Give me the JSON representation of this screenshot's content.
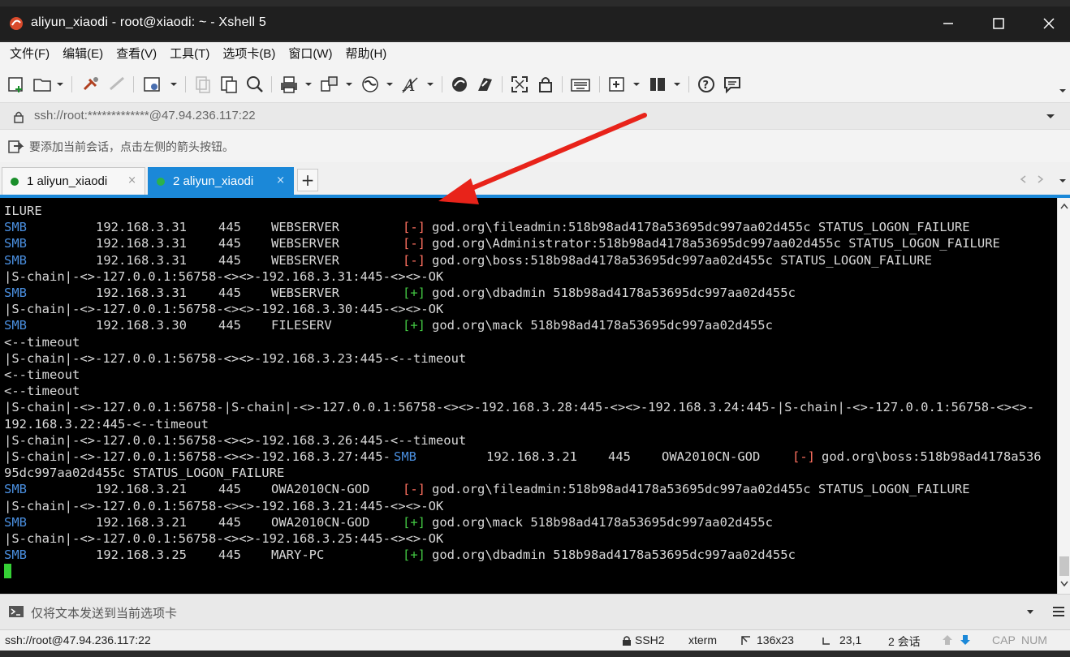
{
  "window": {
    "title": "aliyun_xiaodi - root@xiaodi: ~ - Xshell 5"
  },
  "menu": [
    "文件(F)",
    "编辑(E)",
    "查看(V)",
    "工具(T)",
    "选项卡(B)",
    "窗口(W)",
    "帮助(H)"
  ],
  "address": {
    "url": "ssh://root:*************@47.94.236.117:22"
  },
  "hint": {
    "text": "要添加当前会话，点击左侧的箭头按钮。"
  },
  "tabs": [
    {
      "label": "1 aliyun_xiaodi",
      "close": "×"
    },
    {
      "label": "2 aliyun_xiaodi",
      "close": "×"
    }
  ],
  "tab_add": "+",
  "terminal": {
    "lines": [
      [
        {
          "t": "ILURE",
          "c": ""
        }
      ],
      [
        {
          "t": "SMB",
          "c": "smb"
        },
        {
          "t": "192.168.3.31",
          "c": ""
        },
        {
          "t": "445",
          "c": ""
        },
        {
          "t": "WEBSERVER",
          "c": ""
        },
        {
          "t": "[-]",
          "c": "red"
        },
        {
          "t": "god.org\\fileadmin:518b98ad4178a53695dc997aa02d455c STATUS_LOGON_FAILURE",
          "c": ""
        }
      ],
      [
        {
          "t": "SMB",
          "c": "smb"
        },
        {
          "t": "192.168.3.31",
          "c": ""
        },
        {
          "t": "445",
          "c": ""
        },
        {
          "t": "WEBSERVER",
          "c": ""
        },
        {
          "t": "[-]",
          "c": "red"
        },
        {
          "t": "god.org\\Administrator:518b98ad4178a53695dc997aa02d455c STATUS_LOGON_FAILURE",
          "c": ""
        }
      ],
      [
        {
          "t": "SMB",
          "c": "smb"
        },
        {
          "t": "192.168.3.31",
          "c": ""
        },
        {
          "t": "445",
          "c": ""
        },
        {
          "t": "WEBSERVER",
          "c": ""
        },
        {
          "t": "[-]",
          "c": "red"
        },
        {
          "t": "god.org\\boss:518b98ad4178a53695dc997aa02d455c STATUS_LOGON_FAILURE",
          "c": ""
        }
      ],
      [
        {
          "t": "|S-chain|-<>-127.0.0.1:56758-<><>-192.168.3.31:445-<><>-OK",
          "c": ""
        }
      ],
      [
        {
          "t": "SMB",
          "c": "smb"
        },
        {
          "t": "192.168.3.31",
          "c": ""
        },
        {
          "t": "445",
          "c": ""
        },
        {
          "t": "WEBSERVER",
          "c": ""
        },
        {
          "t": "[+]",
          "c": "grn"
        },
        {
          "t": "god.org\\dbadmin 518b98ad4178a53695dc997aa02d455c",
          "c": ""
        }
      ],
      [
        {
          "t": "|S-chain|-<>-127.0.0.1:56758-<><>-192.168.3.30:445-<><>-OK",
          "c": ""
        }
      ],
      [
        {
          "t": "SMB",
          "c": "smb"
        },
        {
          "t": "192.168.3.30",
          "c": ""
        },
        {
          "t": "445",
          "c": ""
        },
        {
          "t": "FILESERV",
          "c": ""
        },
        {
          "t": "[+]",
          "c": "grn"
        },
        {
          "t": "god.org\\mack 518b98ad4178a53695dc997aa02d455c",
          "c": ""
        }
      ],
      [
        {
          "t": "<--timeout",
          "c": ""
        }
      ],
      [
        {
          "t": "|S-chain|-<>-127.0.0.1:56758-<><>-192.168.3.23:445-<--timeout",
          "c": ""
        }
      ],
      [
        {
          "t": "<--timeout",
          "c": ""
        }
      ],
      [
        {
          "t": "<--timeout",
          "c": ""
        }
      ],
      [
        {
          "t": "|S-chain|-<>-127.0.0.1:56758-|S-chain|-<>-127.0.0.1:56758-<><>-192.168.3.28:445-<><>-192.168.3.24:445-|S-chain|-<>-127.0.0.1:56758-<><>-",
          "c": ""
        }
      ],
      [
        {
          "t": "192.168.3.22:445-<--timeout",
          "c": ""
        }
      ],
      [
        {
          "t": "|S-chain|-<>-127.0.0.1:56758-<><>-192.168.3.26:445-<--timeout",
          "c": ""
        }
      ],
      [
        {
          "t": "|S-chain|-<>-127.0.0.1:56758-<><>-192.168.3.27:445-",
          "c": ""
        },
        {
          "t": "SMB",
          "c": "smb"
        },
        {
          "t": "192.168.3.21",
          "c": ""
        },
        {
          "t": "445",
          "c": ""
        },
        {
          "t": "OWA2010CN-GOD",
          "c": ""
        },
        {
          "t": "[-]",
          "c": "red"
        },
        {
          "t": "god.org\\boss:518b98ad4178a536",
          "c": ""
        }
      ],
      [
        {
          "t": "95dc997aa02d455c STATUS_LOGON_FAILURE",
          "c": ""
        }
      ],
      [
        {
          "t": "SMB",
          "c": "smb"
        },
        {
          "t": "192.168.3.21",
          "c": ""
        },
        {
          "t": "445",
          "c": ""
        },
        {
          "t": "OWA2010CN-GOD",
          "c": ""
        },
        {
          "t": "[-]",
          "c": "red"
        },
        {
          "t": "god.org\\fileadmin:518b98ad4178a53695dc997aa02d455c STATUS_LOGON_FAILURE",
          "c": ""
        }
      ],
      [
        {
          "t": "|S-chain|-<>-127.0.0.1:56758-<><>-192.168.3.21:445-<><>-OK",
          "c": ""
        }
      ],
      [
        {
          "t": "SMB",
          "c": "smb"
        },
        {
          "t": "192.168.3.21",
          "c": ""
        },
        {
          "t": "445",
          "c": ""
        },
        {
          "t": "OWA2010CN-GOD",
          "c": ""
        },
        {
          "t": "[+]",
          "c": "grn"
        },
        {
          "t": "god.org\\mack 518b98ad4178a53695dc997aa02d455c",
          "c": ""
        }
      ],
      [
        {
          "t": "|S-chain|-<>-127.0.0.1:56758-<><>-192.168.3.25:445-<><>-OK",
          "c": ""
        }
      ],
      [
        {
          "t": "SMB",
          "c": "smb"
        },
        {
          "t": "192.168.3.25",
          "c": ""
        },
        {
          "t": "445",
          "c": ""
        },
        {
          "t": "MARY-PC",
          "c": ""
        },
        {
          "t": "[+]",
          "c": "grn"
        },
        {
          "t": "god.org\\dbadmin 518b98ad4178a53695dc997aa02d455c",
          "c": ""
        }
      ]
    ]
  },
  "send_bar": {
    "text": "仅将文本发送到当前选项卡"
  },
  "status": {
    "session": "ssh://root@47.94.236.117:22",
    "protocol": "SSH2",
    "term": "xterm",
    "size": "136x23",
    "pos": "23,1",
    "sessions": "2 会话",
    "caps": "CAP",
    "num": "NUM"
  },
  "colors": {
    "accent": "#1b88d8",
    "smb": "#4a8fe0",
    "fail": "#ff7060",
    "ok": "#43c843",
    "arrow": "#e8231a"
  }
}
